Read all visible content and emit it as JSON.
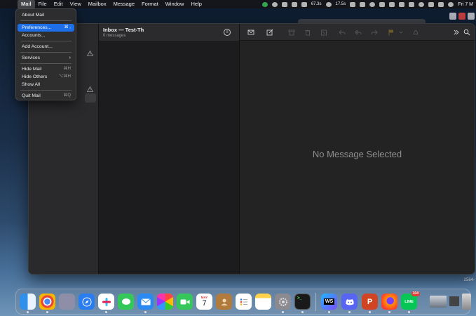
{
  "menubar": {
    "apple_glyph": "",
    "items": [
      "Mail",
      "File",
      "Edit",
      "View",
      "Mailbox",
      "Message",
      "Format",
      "Window",
      "Help"
    ],
    "status": {
      "stats": "67.3s",
      "stats2": "17.5s",
      "clock": "Fri 7 M"
    }
  },
  "app_menu": {
    "title": "Mail",
    "items": {
      "about": "About Mail",
      "preferences": "Preferences...",
      "preferences_shortcut": "⌘ ,",
      "accounts": "Accounts...",
      "add_account": "Add Account...",
      "services": "Services",
      "services_arrow": "›",
      "hide_mail": "Hide Mail",
      "hide_mail_shortcut": "⌘H",
      "hide_others": "Hide Others",
      "hide_others_shortcut": "⌥⌘H",
      "show_all": "Show All",
      "quit": "Quit Mail",
      "quit_shortcut": "⌘Q"
    }
  },
  "mail": {
    "list_title": "Inbox — Test-Th",
    "list_count": "0 messages",
    "empty_state": "No Message Selected"
  },
  "dock": {
    "calendar_month": "MAY",
    "calendar_day": "7",
    "line_badge": "104",
    "ws_label": "WS",
    "ppt_label": "P",
    "line_label": "LINE"
  },
  "desktop": {
    "label_1": "2564-"
  },
  "colors": {
    "highlight": "#1d6ee7",
    "window_bg": "#1e1e1e",
    "flag": "#e0a020"
  }
}
